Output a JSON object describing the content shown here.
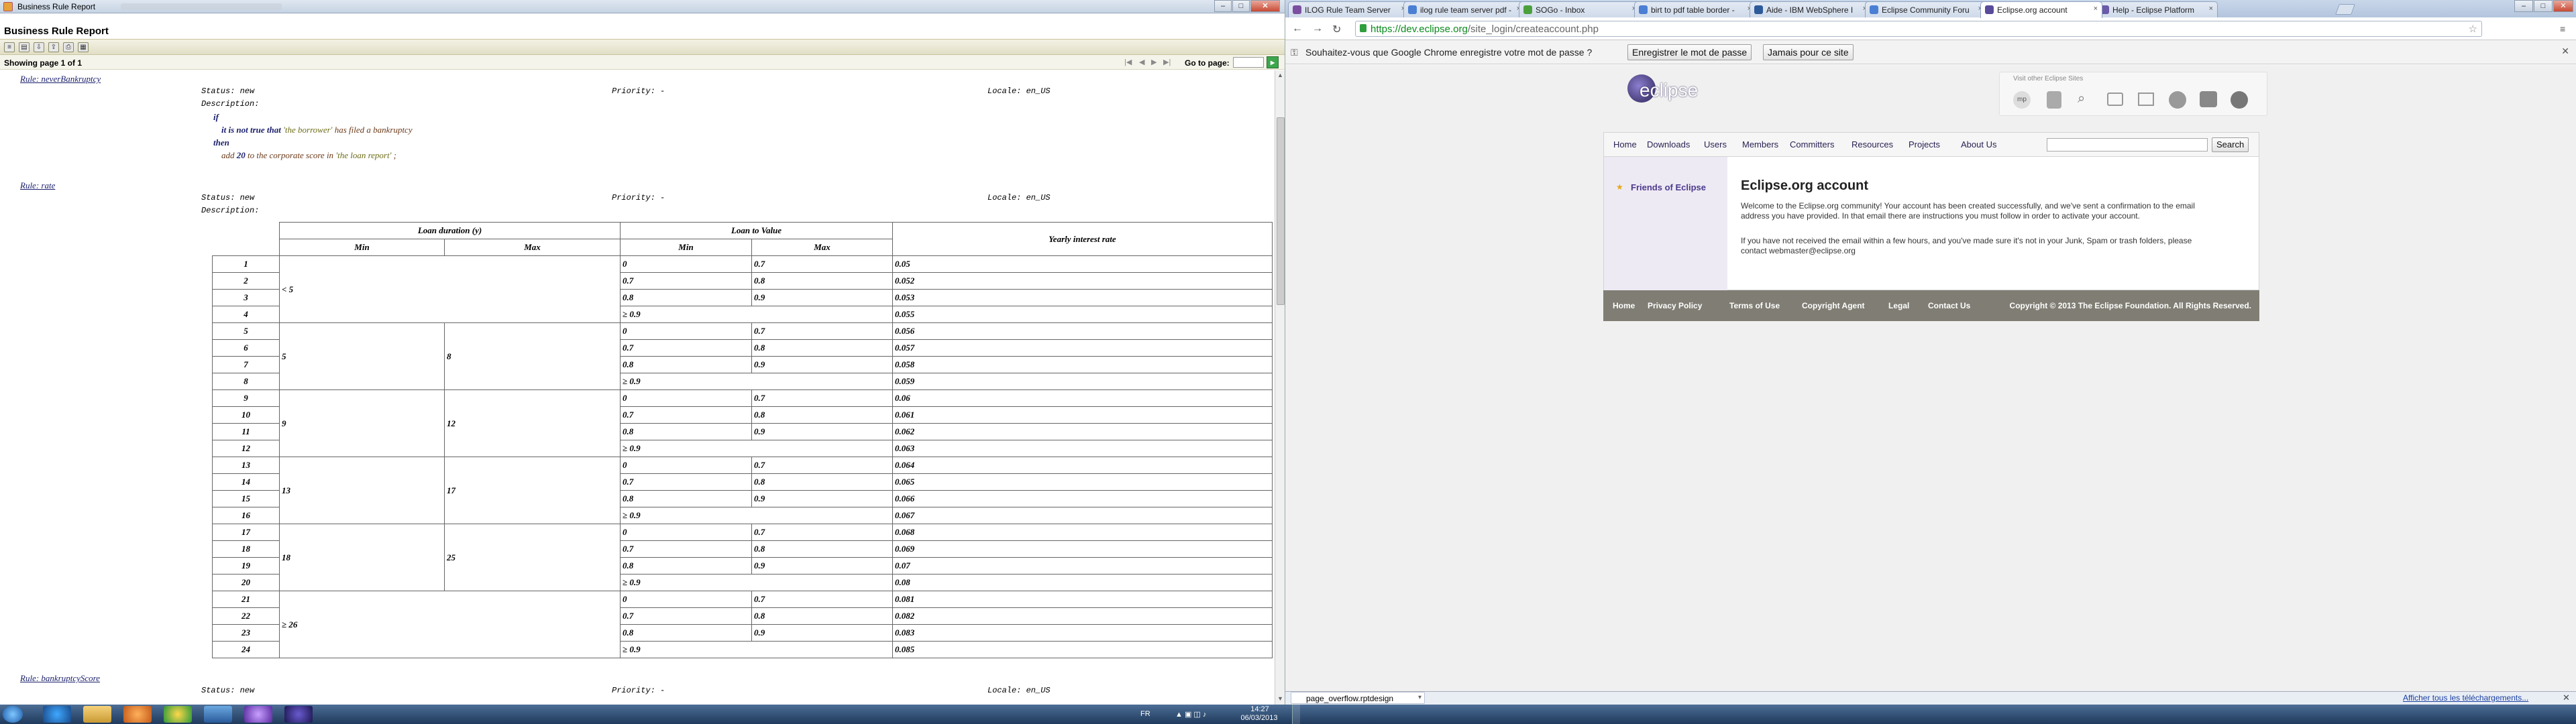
{
  "left_window": {
    "title": "Business Rule Report",
    "report_title": "Business Rule Report",
    "pager": {
      "showing": "Showing page  1  of  1",
      "goto_label": "Go to page:",
      "goto_value": "",
      "nav": [
        "|◀",
        "◀",
        "▶",
        "▶|"
      ]
    },
    "rules": [
      {
        "name": "Rule: neverBankruptcy",
        "status": "Status: new",
        "priority": "Priority: -",
        "locale": "Locale: en_US",
        "description": "Description:",
        "code": {
          "if": "if",
          "line1_a": "it is not true that",
          "line1_var": "'the borrower'",
          "line1_b": "has filed a bankruptcy",
          "then": "then",
          "line2_a": "add",
          "line2_num": "20",
          "line2_b": "to the corporate score in",
          "line2_var": "'the loan report'",
          "line2_end": ";"
        }
      },
      {
        "name": "Rule: rate",
        "status": "Status: new",
        "priority": "Priority: -",
        "locale": "Locale: en_US",
        "description": "Description:"
      },
      {
        "name": "Rule: bankruptcyScore",
        "status": "Status: new",
        "priority": "Priority: -",
        "locale": "Locale: en_US"
      }
    ],
    "table": {
      "header_loan_duration": "Loan duration (y)",
      "header_loan_to_value": "Loan to Value",
      "header_rate": "Yearly interest rate",
      "sub_min": "Min",
      "sub_max": "Max",
      "groups": [
        {
          "dmin": "< 5",
          "dmax": ""
        },
        {
          "dmin": "5",
          "dmax": "8"
        },
        {
          "dmin": "9",
          "dmax": "12"
        },
        {
          "dmin": "13",
          "dmax": "17"
        },
        {
          "dmin": "18",
          "dmax": "25"
        },
        {
          "dmin": "≥ 26",
          "dmax": ""
        }
      ],
      "rows": [
        [
          "1",
          "0",
          "0.7",
          "0.05"
        ],
        [
          "2",
          "0.7",
          "0.8",
          "0.052"
        ],
        [
          "3",
          "0.8",
          "0.9",
          "0.053"
        ],
        [
          "4",
          "≥ 0.9",
          "",
          "0.055"
        ],
        [
          "5",
          "0",
          "0.7",
          "0.056"
        ],
        [
          "6",
          "0.7",
          "0.8",
          "0.057"
        ],
        [
          "7",
          "0.8",
          "0.9",
          "0.058"
        ],
        [
          "8",
          "≥ 0.9",
          "",
          "0.059"
        ],
        [
          "9",
          "0",
          "0.7",
          "0.06"
        ],
        [
          "10",
          "0.7",
          "0.8",
          "0.061"
        ],
        [
          "11",
          "0.8",
          "0.9",
          "0.062"
        ],
        [
          "12",
          "≥ 0.9",
          "",
          "0.063"
        ],
        [
          "13",
          "0",
          "0.7",
          "0.064"
        ],
        [
          "14",
          "0.7",
          "0.8",
          "0.065"
        ],
        [
          "15",
          "0.8",
          "0.9",
          "0.066"
        ],
        [
          "16",
          "≥ 0.9",
          "",
          "0.067"
        ],
        [
          "17",
          "0",
          "0.7",
          "0.068"
        ],
        [
          "18",
          "0.7",
          "0.8",
          "0.069"
        ],
        [
          "19",
          "0.8",
          "0.9",
          "0.07"
        ],
        [
          "20",
          "≥ 0.9",
          "",
          "0.08"
        ],
        [
          "21",
          "0",
          "0.7",
          "0.081"
        ],
        [
          "22",
          "0.7",
          "0.8",
          "0.082"
        ],
        [
          "23",
          "0.8",
          "0.9",
          "0.083"
        ],
        [
          "24",
          "≥ 0.9",
          "",
          "0.085"
        ]
      ]
    }
  },
  "browser": {
    "tabs": [
      {
        "label": "ILOG Rule Team Server",
        "fav": "#7b4fa0"
      },
      {
        "label": "ilog rule team server pdf -",
        "fav": "#4a7fd4"
      },
      {
        "label": "SOGo - Inbox",
        "fav": "#4ba03c"
      },
      {
        "label": "birt to pdf table border -",
        "fav": "#4a7fd4"
      },
      {
        "label": "Aide - IBM WebSphere I",
        "fav": "#2d5b9a"
      },
      {
        "label": "Eclipse Community Foru",
        "fav": "#4a7fd4"
      },
      {
        "label": "Eclipse.org account",
        "fav": "#5a4b9a"
      },
      {
        "label": "Help - Eclipse Platform",
        "fav": "#6b5aa8"
      }
    ],
    "url_host": "https://dev.eclipse.org",
    "url_path": "/site_login/createaccount.php",
    "password_bar": {
      "message": "Souhaitez-vous que Google Chrome enregistre votre mot de passe ?",
      "save": "Enregistrer le mot de passe",
      "never": "Jamais pour ce site"
    },
    "page": {
      "logo": "eclipse",
      "visit_other": "Visit other Eclipse Sites",
      "nav": [
        "Home",
        "Downloads",
        "Users",
        "Members",
        "Committers",
        "Resources",
        "Projects",
        "About Us"
      ],
      "search_placeholder": "",
      "search_button": "Search",
      "sidebar_link": "Friends of Eclipse",
      "heading": "Eclipse.org account",
      "para1": "Welcome to the Eclipse.org community! Your account has been created successfully, and we've sent a confirmation to the email address you have provided. In that email there are instructions you must follow in order to activate your account.",
      "para2": "If you have not received the email within a few hours, and you've made sure it's not in your Junk, Spam or trash folders, please contact webmaster@eclipse.org",
      "footer_links": [
        "Home",
        "Privacy Policy",
        "Terms of Use",
        "Copyright Agent",
        "Legal",
        "Contact Us"
      ],
      "copyright": "Copyright © 2013 The Eclipse Foundation. All Rights Reserved."
    },
    "download": {
      "file": "page_overflow.rptdesign",
      "show_all": "Afficher tous les téléchargements..."
    }
  },
  "taskbar": {
    "lang": "FR",
    "time": "14:27",
    "date": "06/03/2013"
  },
  "colors": {
    "report_toolbar": "#e2dfc6",
    "eclipse_purple": "#2c2255",
    "eclipse_nav_bg": "#f2f2f2",
    "footer_bg": "#807e74"
  }
}
